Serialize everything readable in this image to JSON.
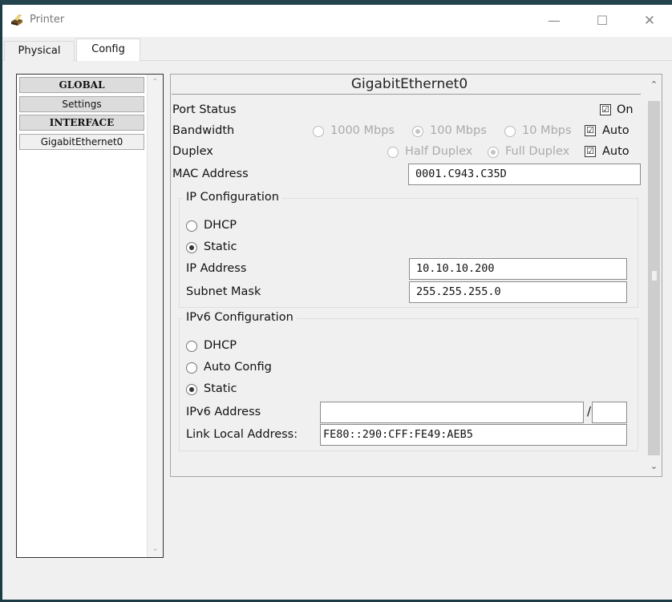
{
  "window": {
    "title": "Printer",
    "icon": "printer-icon",
    "controls": {
      "minimize": "—",
      "maximize": "☐",
      "close": "✕"
    }
  },
  "tabs": [
    {
      "label": "Physical",
      "active": false
    },
    {
      "label": "Config",
      "active": true
    }
  ],
  "sidebar": {
    "items": [
      {
        "label": "GLOBAL",
        "type": "header"
      },
      {
        "label": "Settings",
        "type": "item"
      },
      {
        "label": "INTERFACE",
        "type": "header"
      },
      {
        "label": "GigabitEthernet0",
        "type": "item",
        "selected": true
      }
    ]
  },
  "interface": {
    "title": "GigabitEthernet0",
    "port_status": {
      "label": "Port Status",
      "on_label": "On",
      "on_checked": true
    },
    "bandwidth": {
      "label": "Bandwidth",
      "options": [
        "1000 Mbps",
        "100 Mbps",
        "10 Mbps"
      ],
      "selected": "100 Mbps",
      "auto_label": "Auto",
      "auto_checked": true
    },
    "duplex": {
      "label": "Duplex",
      "options": [
        "Half Duplex",
        "Full Duplex"
      ],
      "selected": "Full Duplex",
      "auto_label": "Auto",
      "auto_checked": true
    },
    "mac": {
      "label": "MAC Address",
      "value": "0001.C943.C35D"
    },
    "ip_config": {
      "title": "IP Configuration",
      "dhcp_label": "DHCP",
      "static_label": "Static",
      "selected": "Static",
      "ip_label": "IP Address",
      "ip_value": "10.10.10.200",
      "mask_label": "Subnet Mask",
      "mask_value": "255.255.255.0"
    },
    "ipv6_config": {
      "title": "IPv6 Configuration",
      "dhcp_label": "DHCP",
      "auto_label": "Auto Config",
      "static_label": "Static",
      "selected": "Static",
      "address_label": "IPv6 Address",
      "address_value": "",
      "prefix_separator": "/",
      "prefix_value": "",
      "link_local_label": "Link Local Address:",
      "link_local_value": "FE80::290:CFF:FE49:AEB5"
    }
  },
  "icons": {
    "checkmark": "☑",
    "scroll_up": "⌃",
    "scroll_down": "⌄"
  },
  "colors": {
    "desktop": "#1d3b44",
    "panel_bg": "#f0f0f0",
    "scroll_thumb": "#cdcdcd",
    "disabled_text": "#aaaaaa"
  }
}
